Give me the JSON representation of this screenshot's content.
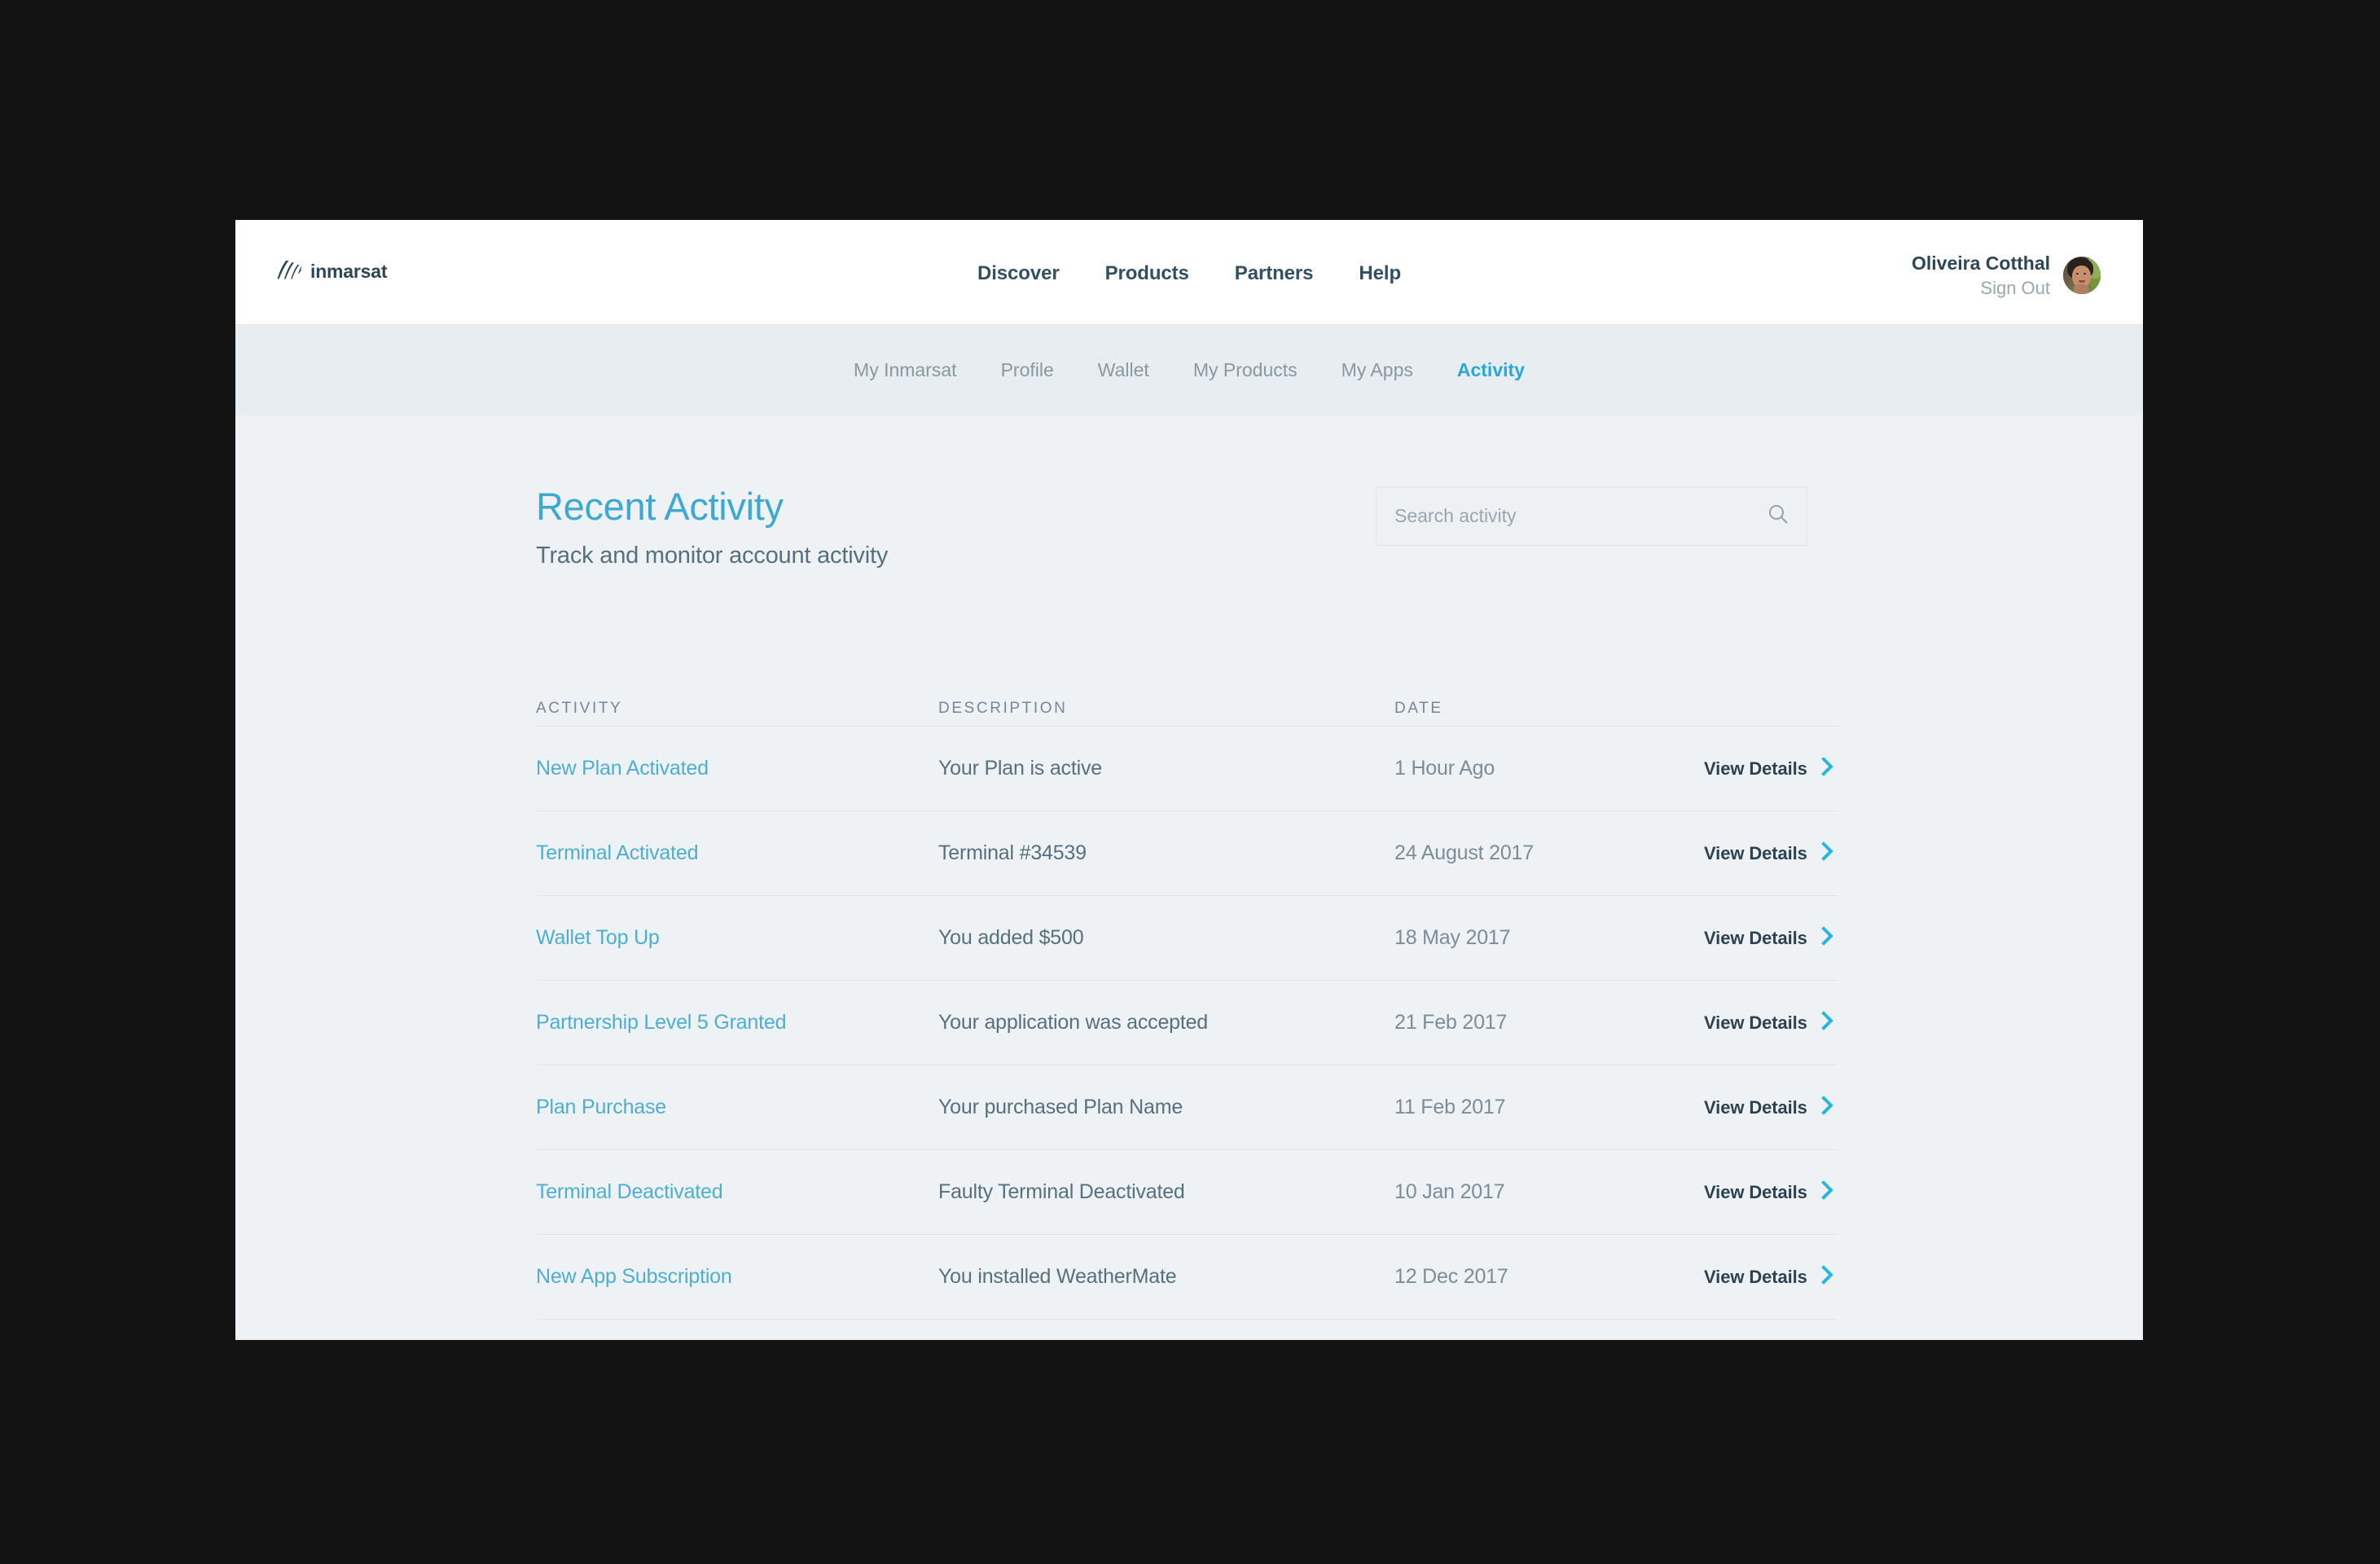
{
  "brand": {
    "name": "inmarsat",
    "mark_icon": "signal-waves-icon",
    "mark_color": "#2d4654"
  },
  "primary_nav": [
    {
      "label": "Discover"
    },
    {
      "label": "Products"
    },
    {
      "label": "Partners"
    },
    {
      "label": "Help"
    }
  ],
  "user": {
    "name": "Oliveira Cotthal",
    "sign_out_label": "Sign Out",
    "avatar_icon": "user-photo-avatar"
  },
  "secondary_nav": [
    {
      "label": "My Inmarsat",
      "active": false
    },
    {
      "label": "Profile",
      "active": false
    },
    {
      "label": "Wallet",
      "active": false
    },
    {
      "label": "My Products",
      "active": false
    },
    {
      "label": "My Apps",
      "active": false
    },
    {
      "label": "Activity",
      "active": true
    }
  ],
  "page": {
    "title": "Recent Activity",
    "subtitle": "Track and monitor account activity",
    "title_color": "#3ea9d0"
  },
  "search": {
    "placeholder": "Search activity",
    "value": "",
    "icon": "search-icon"
  },
  "table": {
    "columns": [
      "ACTIVITY",
      "DESCRIPTION",
      "DATE"
    ],
    "action_label": "View Details",
    "action_icon": "chevron-right-icon",
    "accent_color": "#29b6d8",
    "rows": [
      {
        "activity": "New Plan Activated",
        "description": "Your Plan is active",
        "date": "1 Hour Ago"
      },
      {
        "activity": "Terminal Activated",
        "description": "Terminal #34539",
        "date": "24 August 2017"
      },
      {
        "activity": "Wallet Top Up",
        "description": "You added $500",
        "date": "18 May 2017"
      },
      {
        "activity": "Partnership Level 5 Granted",
        "description": "Your application was accepted",
        "date": "21 Feb 2017"
      },
      {
        "activity": "Plan Purchase",
        "description": "Your purchased Plan Name",
        "date": "11 Feb 2017"
      },
      {
        "activity": "Terminal Deactivated",
        "description": "Faulty Terminal Deactivated",
        "date": "10 Jan 2017"
      },
      {
        "activity": "New App Subscription",
        "description": "You installed WeatherMate",
        "date": "12 Dec 2017"
      }
    ]
  }
}
